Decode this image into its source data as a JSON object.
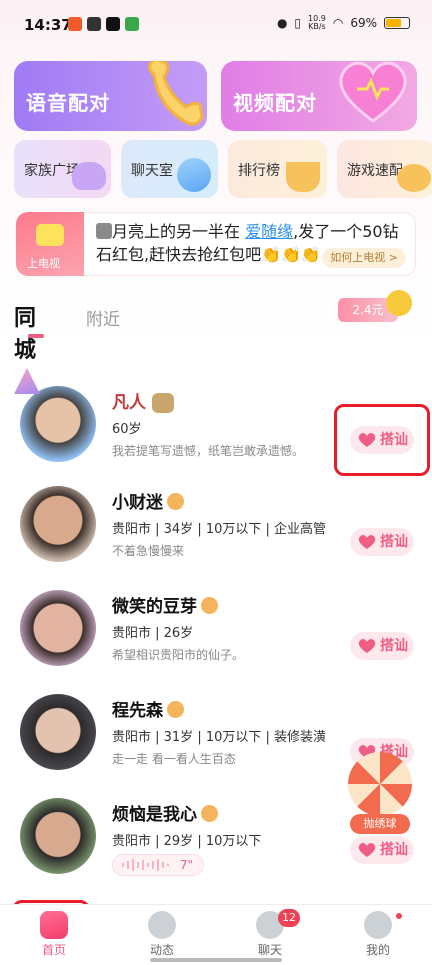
{
  "status_bar": {
    "time": "14:37",
    "network_speed": "10.9\nKB/s",
    "battery": "69%"
  },
  "features": {
    "voice_match": "语音配对",
    "video_match": "视频配对",
    "family_square": "家族广场",
    "chat_room": "聊天室",
    "leaderboard": "排行榜",
    "game_match": "游戏速配"
  },
  "banner": {
    "tv_label": "上电视",
    "message_pre": "月亮上的另一半在 ",
    "message_link": "爱随缘",
    "message_post": ",发了一个50钻石红包,赶快去抢红包吧👏👏👏",
    "how_button": "如何上电视 >"
  },
  "tabs": {
    "active": "同城",
    "nearby": "附近"
  },
  "red_packet_amount": "2.4元",
  "users": [
    {
      "name": "凡人",
      "age": "60岁",
      "info": "",
      "bio": "我若提笔写遗憾，纸笔岂敢承遗憾。",
      "action": "搭讪"
    },
    {
      "name": "小财迷",
      "info": "贵阳市 | 34岁 | 10万以下 | 企业高管",
      "bio": "不着急慢慢来",
      "action": "搭讪"
    },
    {
      "name": "微笑的豆芽",
      "info": "贵阳市 | 26岁",
      "bio": "希望相识贵阳市的仙子。",
      "action": "搭讪"
    },
    {
      "name": "程先森",
      "info": "贵阳市 | 31岁 | 10万以下 | 装修装潢",
      "bio": "走一走 看一看人生百态",
      "action": "搭讪"
    },
    {
      "name": "烦恼是我心",
      "info": "贵阳市 | 29岁 | 10万以下",
      "voice_seconds": "7\"",
      "action": "搭讪"
    }
  ],
  "float_ball": "抛绣球",
  "bottom_nav": {
    "home": "首页",
    "moments": "动态",
    "chat": "聊天",
    "chat_badge": "12",
    "mine": "我的"
  },
  "colors": {
    "accent": "#f05d84",
    "highlight": "#e81c2b"
  }
}
